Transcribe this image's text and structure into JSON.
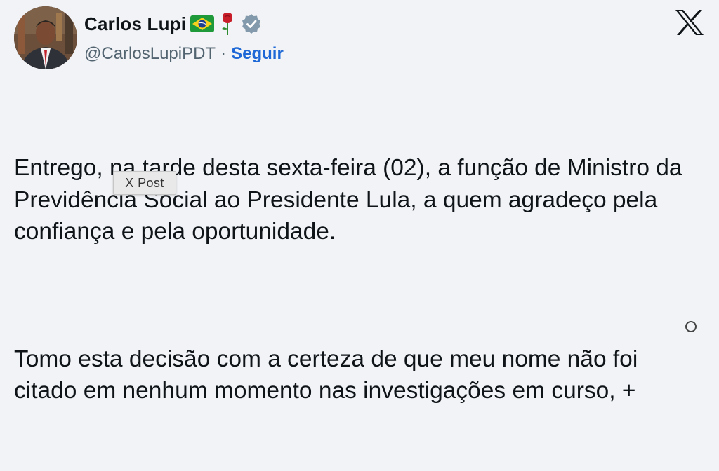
{
  "author": {
    "display_name": "Carlos Lupi",
    "handle": "@CarlosLupiPDT",
    "separator": "·",
    "follow_label": "Seguir"
  },
  "badges": [
    "brazil-flag-icon",
    "rose-icon",
    "verified-badge-icon"
  ],
  "post": {
    "paragraphs": [
      "Entrego, na tarde desta sexta-feira (02), a função de Ministro da Previdência Social ao Presidente Lula, a quem agradeço pela confiança e pela oportunidade.",
      "Tomo esta decisão com a certeza de que meu nome não foi citado em nenhum momento nas investigações em curso, +"
    ]
  },
  "tooltip": {
    "text": "X Post"
  },
  "colors": {
    "background": "#f1f3f6",
    "text": "#0f1419",
    "secondary_text": "#536471",
    "follow": "#1d68d6"
  }
}
